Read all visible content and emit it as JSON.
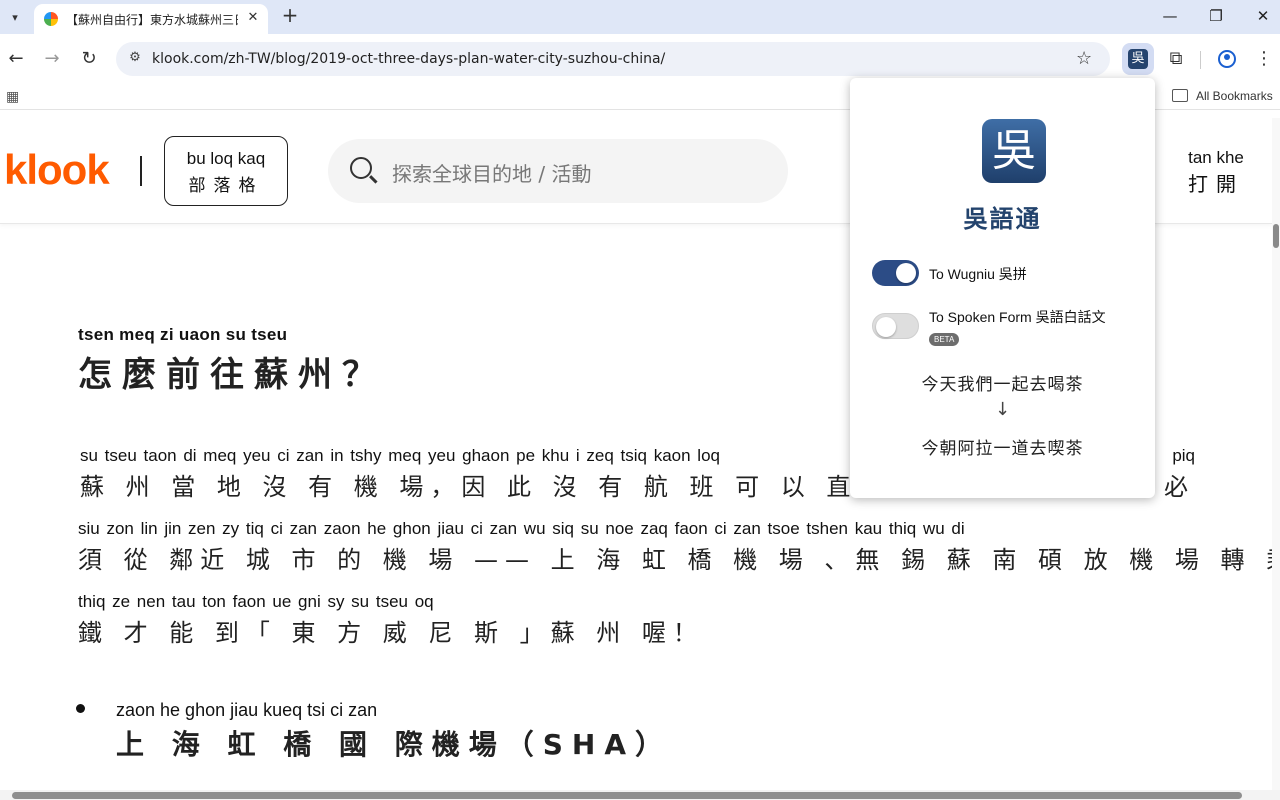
{
  "browser": {
    "tab_title": "【蘇州自由行】東方水城蘇州三日",
    "tab_close": "✕",
    "new_tab": "+",
    "url": "klook.com/zh-TW/blog/2019-oct-three-days-plan-water-city-suzhou-china/",
    "extension_badge": "吳",
    "bookmarks_label": "All Bookmarks"
  },
  "header": {
    "logo": "klook",
    "blog_pinyin": "bu loq kaq",
    "blog_chinese": "部落格",
    "search_placeholder": "探索全球目的地 / 活動",
    "open_app_pinyin": "tan khe",
    "open_app_chinese": "打開"
  },
  "article": {
    "heading_pinyin": "tsen meq   zi   uaon   su   tseu",
    "heading_chinese": "怎麼前往蘇州？",
    "paragraph_lines": [
      {
        "pinyin": "su  tseu taon  di  meq yeu  ci  zan         in  tshy meq yeu ghaon pe khu    i    zeq tsiq kaon loq",
        "chinese": "蘇 州  當 地 沒  有 機 場，因 此  沒  有   航   班 可 以 直 接  降 落"
      },
      {
        "pinyin": "siu zon lin  jin zen  zy  tiq   ci  zan           zaon he ghon jiau   ci  zan        wu siq  su  noe zaq faon   ci  zan tsoe tshen kau thiq wu   di",
        "chinese": "須 從 鄰近 城 市 的 機 場 —— 上  海  虹   橋 機 場 、無 錫 蘇 南  碩  放  機 場  轉    乘   高  鐵  和 地"
      },
      {
        "pinyin": "thiq  ze  nen tau       ton faon ue gni  sy         su  tseu oq",
        "chinese": "鐵 才 能 到「 東  方  威 尼 斯 」蘇  州  喔！"
      }
    ],
    "right_fragment_pinyin": "piq",
    "right_fragment_chinese": "必",
    "bullet_pinyin": "zaon  he  ghon jiau kueq  tsi    ci   zan",
    "bullet_chinese": "上 海 虹 橋 國 際機場（SHA）"
  },
  "popup": {
    "logo_char": "吳",
    "title": "吳語通",
    "option1_label": "To Wugniu 吳拼",
    "option1_on": true,
    "option2_label": "To Spoken Form 吳語白話文",
    "option2_on": false,
    "beta_badge": "BETA",
    "example_before": "今天我們一起去喝茶",
    "example_arrow": "↓",
    "example_after": "今朝阿拉一道去喫茶"
  },
  "colors": {
    "klook_orange": "#ff5b00",
    "toggle_on": "#2c4c86",
    "popup_title": "#23436d"
  }
}
